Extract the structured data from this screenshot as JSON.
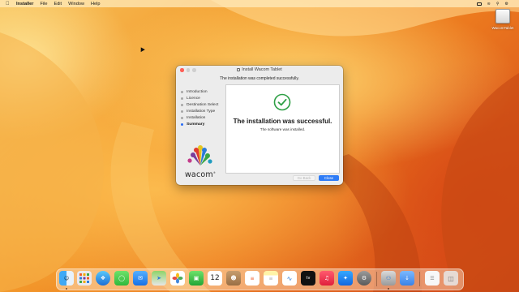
{
  "menubar": {
    "app_name": "Installer",
    "items": [
      "File",
      "Edit",
      "Window",
      "Help"
    ],
    "clock": ""
  },
  "desktop": {
    "disk_label": "WacomTablet"
  },
  "window": {
    "title": "Install Wacom Tablet",
    "subtitle": "The installation was completed successfully.",
    "steps": [
      {
        "label": "Introduction",
        "active": false
      },
      {
        "label": "Licence",
        "active": false
      },
      {
        "label": "Destination Select",
        "active": false
      },
      {
        "label": "Installation Type",
        "active": false
      },
      {
        "label": "Installation",
        "active": false
      },
      {
        "label": "Summary",
        "active": true
      }
    ],
    "logo_text": "wacom",
    "main_heading": "The installation was successful.",
    "main_text": "The software was installed.",
    "back_label": "Go Back",
    "close_label": "Close",
    "accent_color": "#2f7cf6",
    "success_color": "#2e9f45"
  },
  "dock": {
    "calendar_day": "12",
    "calendar_month": "",
    "apps": [
      "finder",
      "launchpad",
      "safari",
      "messages",
      "mail",
      "maps",
      "photos",
      "facetime",
      "calendar",
      "contacts",
      "reminders",
      "notes",
      "freeform",
      "tv",
      "music",
      "app-store",
      "system-settings",
      "installer",
      "downloads",
      "document",
      "trash"
    ],
    "tv_label": "tv"
  }
}
